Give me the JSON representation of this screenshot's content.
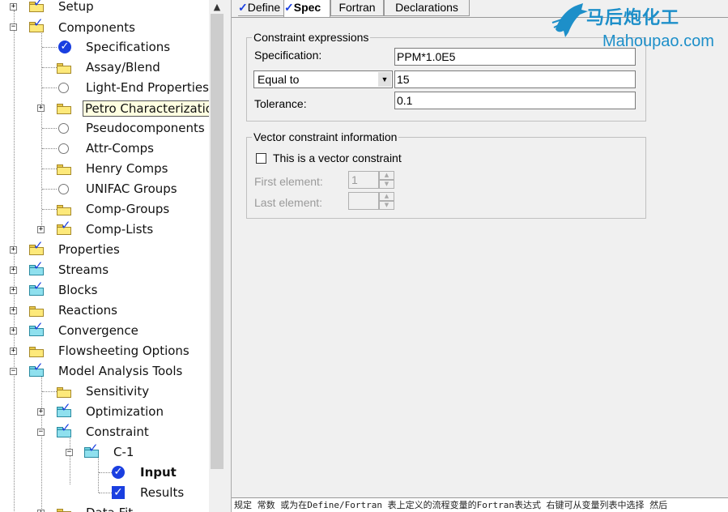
{
  "tree": {
    "nodes": [
      {
        "label": "Setup"
      },
      {
        "label": "Components"
      },
      {
        "label": "Specifications"
      },
      {
        "label": "Assay/Blend"
      },
      {
        "label": "Light-End Properties"
      },
      {
        "label": "Petro Characterization"
      },
      {
        "label": "Pseudocomponents"
      },
      {
        "label": "Attr-Comps"
      },
      {
        "label": "Henry Comps"
      },
      {
        "label": "UNIFAC Groups"
      },
      {
        "label": "Comp-Groups"
      },
      {
        "label": "Comp-Lists"
      },
      {
        "label": "Properties"
      },
      {
        "label": "Streams"
      },
      {
        "label": "Blocks"
      },
      {
        "label": "Reactions"
      },
      {
        "label": "Convergence"
      },
      {
        "label": "Flowsheeting Options"
      },
      {
        "label": "Model Analysis Tools"
      },
      {
        "label": "Sensitivity"
      },
      {
        "label": "Optimization"
      },
      {
        "label": "Constraint"
      },
      {
        "label": "C-1"
      },
      {
        "label": "Input"
      },
      {
        "label": "Results"
      },
      {
        "label": "Data Fit"
      }
    ],
    "expander_plus": "+",
    "expander_minus": "−",
    "check_mark": "✓"
  },
  "scrollbar": {
    "up_arrow": "▲"
  },
  "tabs": {
    "define": "Define",
    "spec": "Spec",
    "fortran": "Fortran",
    "declarations": "Declarations",
    "check_mark": "✓"
  },
  "constraint_expressions": {
    "title": "Constraint expressions",
    "specification_label": "Specification:",
    "specification_value": "PPM*1.0E5",
    "operator_value": "Equal to",
    "operator_value_field": "15",
    "tolerance_label": "Tolerance:",
    "tolerance_value": "0.1"
  },
  "vector_constraint": {
    "title": "Vector constraint information",
    "checkbox_label": "This is a vector constraint",
    "first_element_label": "First element:",
    "first_element_value": "1",
    "last_element_label": "Last element:",
    "last_element_value": ""
  },
  "status_bar": {
    "text": "规定 常数 或为在Define/Fortran 表上定义的流程变量的Fortran表达式 右键可从变量列表中选择 然后"
  },
  "watermark": {
    "chinese": "马后炮化工",
    "english": "Mahoupao.com"
  },
  "colors": {
    "accent_blue": "#1a3fe0",
    "folder_yellow": "#fde97a",
    "watermark": "#1d8fc9"
  }
}
